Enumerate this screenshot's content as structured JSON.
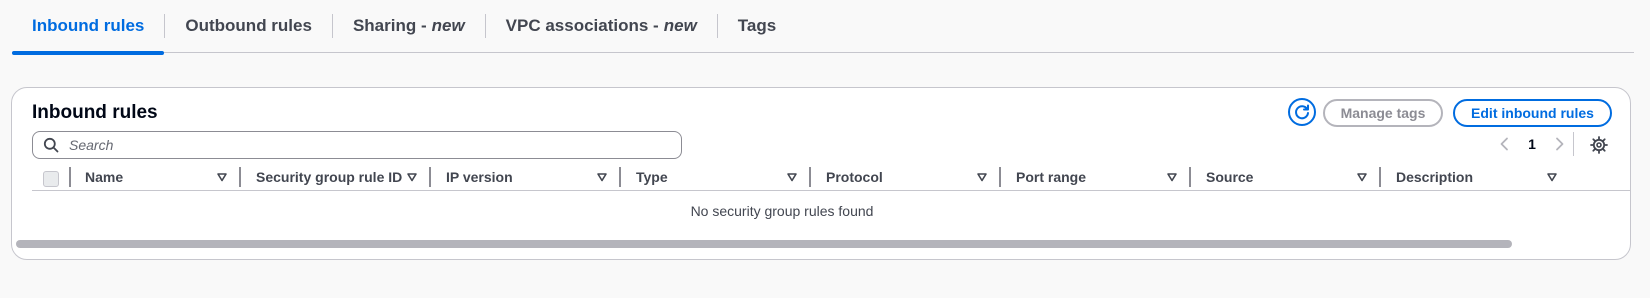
{
  "tabs": [
    {
      "label": "Inbound rules",
      "suffix": ""
    },
    {
      "label": "Outbound rules",
      "suffix": ""
    },
    {
      "label": "Sharing -",
      "suffix": "new"
    },
    {
      "label": "VPC associations -",
      "suffix": "new"
    },
    {
      "label": "Tags",
      "suffix": ""
    }
  ],
  "active_tab": "Inbound rules",
  "panel": {
    "title": "Inbound rules",
    "manage_tags_label": "Manage tags",
    "edit_rules_label": "Edit inbound rules",
    "search_placeholder": "Search",
    "page_number": "1"
  },
  "table": {
    "columns": [
      "Name",
      "Security group rule ID",
      "IP version",
      "Type",
      "Protocol",
      "Port range",
      "Source",
      "Description"
    ],
    "empty_message": "No security group rules found"
  },
  "icons": {
    "refresh": "refresh-icon",
    "search": "search-icon",
    "settings": "gear-icon",
    "sort": "sort-caret-icon"
  },
  "colors": {
    "accent": "#006ce0",
    "disabled": "#8c8c94",
    "border": "#c6c6cd"
  }
}
